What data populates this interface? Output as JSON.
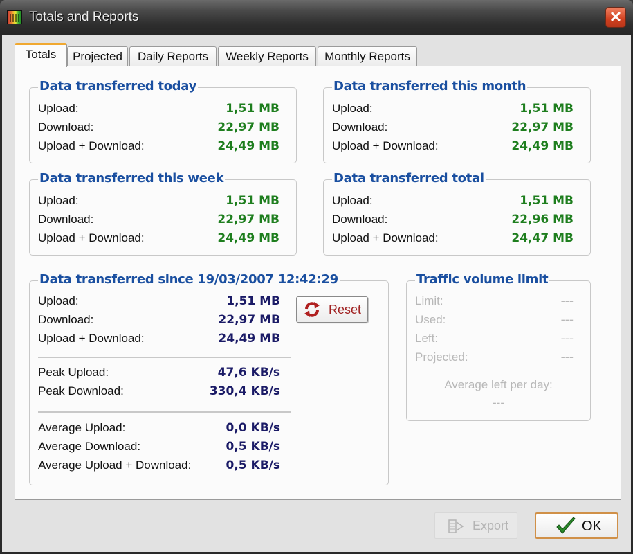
{
  "window": {
    "title": "Totals and Reports",
    "close_symbol": "✕"
  },
  "tabs": [
    {
      "label": "Totals",
      "active": true
    },
    {
      "label": "Projected",
      "active": false
    },
    {
      "label": "Daily Reports",
      "active": false
    },
    {
      "label": "Weekly Reports",
      "active": false
    },
    {
      "label": "Monthly Reports",
      "active": false
    }
  ],
  "today": {
    "title": "Data transferred today",
    "rows": [
      {
        "label": "Upload:",
        "value": "1,51 MB"
      },
      {
        "label": "Download:",
        "value": "22,97 MB"
      },
      {
        "label": "Upload + Download:",
        "value": "24,49 MB"
      }
    ]
  },
  "month": {
    "title": "Data transferred this month",
    "rows": [
      {
        "label": "Upload:",
        "value": "1,51 MB"
      },
      {
        "label": "Download:",
        "value": "22,97 MB"
      },
      {
        "label": "Upload + Download:",
        "value": "24,49 MB"
      }
    ]
  },
  "week": {
    "title": "Data transferred this week",
    "rows": [
      {
        "label": "Upload:",
        "value": "1,51 MB"
      },
      {
        "label": "Download:",
        "value": "22,97 MB"
      },
      {
        "label": "Upload + Download:",
        "value": "24,49 MB"
      }
    ]
  },
  "total": {
    "title": "Data transferred total",
    "rows": [
      {
        "label": "Upload:",
        "value": "1,51 MB"
      },
      {
        "label": "Download:",
        "value": "22,96 MB"
      },
      {
        "label": "Upload + Download:",
        "value": "24,47 MB"
      }
    ]
  },
  "since": {
    "title": "Data transferred since 19/03/2007 12:42:29",
    "rows": [
      {
        "label": "Upload:",
        "value": "1,51 MB"
      },
      {
        "label": "Download:",
        "value": "22,97 MB"
      },
      {
        "label": "Upload + Download:",
        "value": "24,49 MB"
      }
    ],
    "peak": [
      {
        "label": "Peak Upload:",
        "value": "47,6 KB/s"
      },
      {
        "label": "Peak Download:",
        "value": "330,4 KB/s"
      }
    ],
    "average": [
      {
        "label": "Average Upload:",
        "value": "0,0 KB/s"
      },
      {
        "label": "Average Download:",
        "value": "0,5 KB/s"
      },
      {
        "label": "Average Upload + Download:",
        "value": "0,5 KB/s"
      }
    ],
    "reset_label": "Reset"
  },
  "limit": {
    "title": "Traffic volume limit",
    "rows": [
      {
        "label": "Limit:",
        "value": "---"
      },
      {
        "label": "Used:",
        "value": "---"
      },
      {
        "label": "Left:",
        "value": "---"
      },
      {
        "label": "Projected:",
        "value": "---"
      }
    ],
    "avg_label": "Average left per day:",
    "avg_value": "---"
  },
  "buttons": {
    "export_label": "Export",
    "ok_label": "OK"
  },
  "colors": {
    "title_blue": "#1a4fa0",
    "value_green": "#1e7e1e",
    "value_navy": "#1a1a66",
    "reset_red": "#a02020",
    "active_tab_accent": "#f0a830"
  }
}
